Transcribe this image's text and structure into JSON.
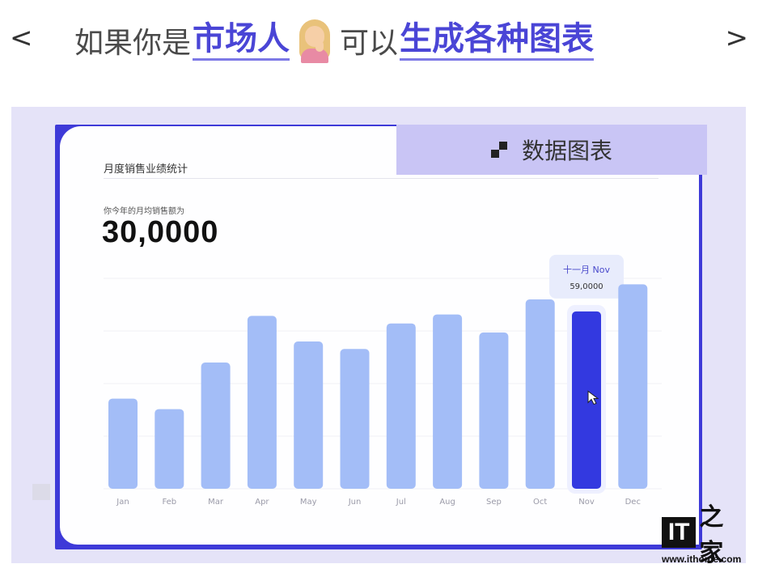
{
  "header": {
    "prev": "<",
    "next": ">",
    "part1": "如果你是",
    "part2": "市场人",
    "part3": "可以",
    "part4": "生成各种图表"
  },
  "tag": {
    "label": "数据图表",
    "icon": "grid-squares-icon"
  },
  "card": {
    "title": "月度销售业绩统计",
    "avg_label": "你今年的月均销售额为",
    "avg_value": "30,0000"
  },
  "tooltip": {
    "title": "十一月 Nov",
    "value": "59,0000"
  },
  "watermark": {
    "brand": "IT",
    "char": "之家",
    "url": "www.ithome.com"
  },
  "colors": {
    "bar": "#a3bdf7",
    "bar_selected": "#3339e0",
    "accent": "#4a45d6",
    "tag_bg": "#c9c5f5",
    "frame": "#3e3ad8"
  },
  "chart_data": {
    "type": "bar",
    "title": "月度销售业绩统计",
    "categories": [
      "Jan",
      "Feb",
      "Mar",
      "Apr",
      "May",
      "Jun",
      "Jul",
      "Aug",
      "Sep",
      "Oct",
      "Nov",
      "Dec"
    ],
    "values": [
      30,
      26.5,
      42,
      57.5,
      49,
      46.5,
      55,
      58,
      52,
      63,
      59,
      68
    ],
    "ylim": [
      0,
      70
    ],
    "selected_index": 10,
    "grid": true,
    "ylabel": "",
    "xlabel": ""
  }
}
